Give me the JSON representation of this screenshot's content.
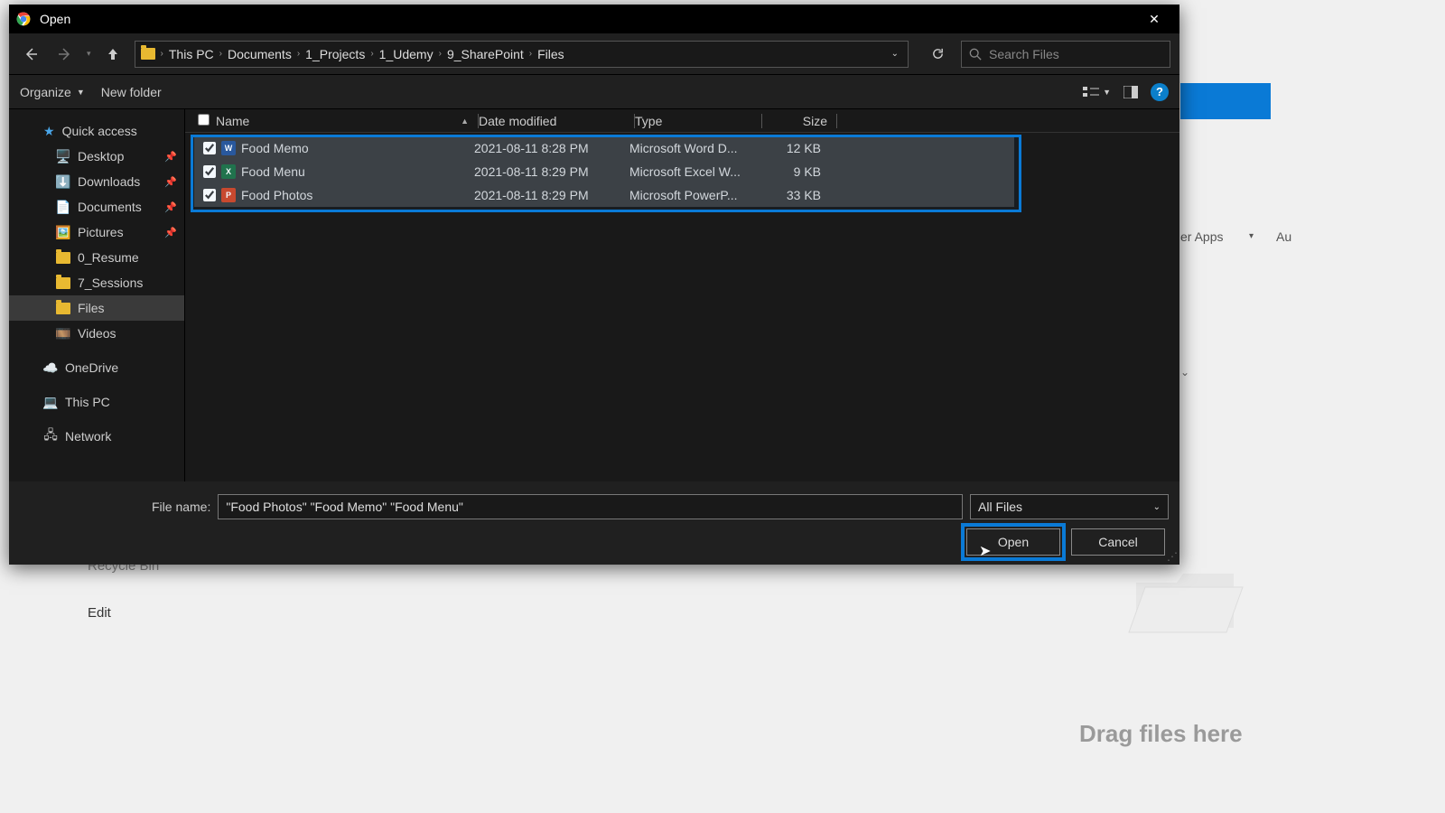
{
  "title": "Open",
  "breadcrumbs": [
    "This PC",
    "Documents",
    "1_Projects",
    "1_Udemy",
    "9_SharePoint",
    "Files"
  ],
  "search_placeholder": "Search Files",
  "toolbar": {
    "organize": "Organize",
    "new_folder": "New folder"
  },
  "columns": {
    "name": "Name",
    "date": "Date modified",
    "type": "Type",
    "size": "Size"
  },
  "sidebar": {
    "quick_access": "Quick access",
    "desktop": "Desktop",
    "downloads": "Downloads",
    "documents": "Documents",
    "pictures": "Pictures",
    "resume": "0_Resume",
    "sessions": "7_Sessions",
    "files": "Files",
    "videos": "Videos",
    "onedrive": "OneDrive",
    "this_pc": "This PC",
    "network": "Network"
  },
  "files": [
    {
      "name": "Food Memo",
      "date": "2021-08-11 8:28 PM",
      "type": "Microsoft Word D...",
      "size": "12 KB",
      "app": "W",
      "color": "fi-w"
    },
    {
      "name": "Food Menu",
      "date": "2021-08-11 8:29 PM",
      "type": "Microsoft Excel W...",
      "size": "9 KB",
      "app": "X",
      "color": "fi-x"
    },
    {
      "name": "Food Photos",
      "date": "2021-08-11 8:29 PM",
      "type": "Microsoft PowerP...",
      "size": "33 KB",
      "app": "P",
      "color": "fi-p"
    }
  ],
  "file_name_label": "File name:",
  "file_name_value": "\"Food Photos\" \"Food Memo\" \"Food Menu\"",
  "file_type": "All Files",
  "open_btn": "Open",
  "cancel_btn": "Cancel",
  "bg": {
    "apps": "er Apps",
    "au": "Au",
    "edit": "Edit",
    "recycle": "Recycle Bin",
    "drag": "Drag files here"
  }
}
